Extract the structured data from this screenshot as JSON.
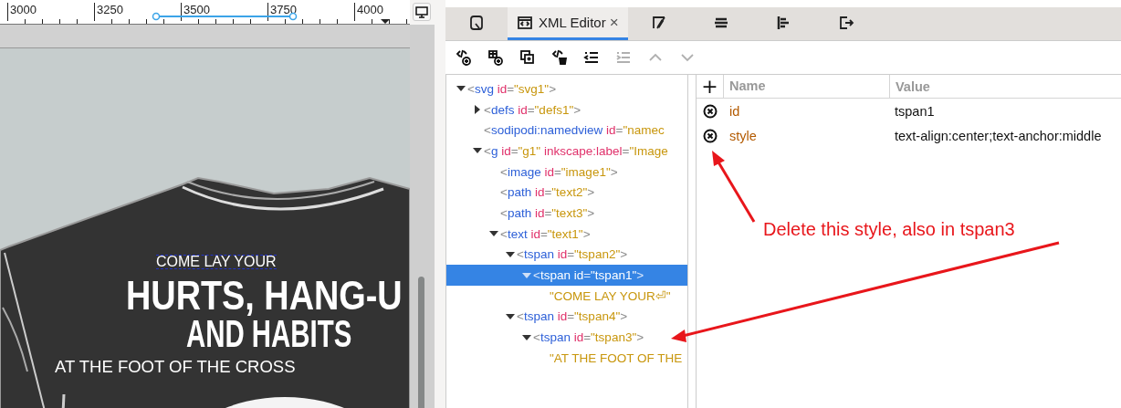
{
  "ruler": {
    "labels": [
      "3000",
      "3250",
      "3500",
      "3750",
      "4000"
    ]
  },
  "canvas": {
    "texts": [
      {
        "text": "COME LAY YOUR",
        "kind": "selected"
      },
      {
        "text": "HURTS, HANG-U",
        "kind": "headline"
      },
      {
        "text": "AND HABITS",
        "kind": "headline2"
      },
      {
        "text": "AT THE FOOT OF THE CROSS",
        "kind": "plain"
      }
    ]
  },
  "tabs": [
    {
      "selected": false
    },
    {
      "label": "XML Editor",
      "close": "×",
      "selected": true
    },
    {
      "selected": false
    },
    {
      "selected": false
    },
    {
      "selected": false
    },
    {
      "selected": false
    }
  ],
  "toolbar": [
    {
      "disabled": false
    },
    {
      "disabled": false
    },
    {
      "disabled": false
    },
    {
      "disabled": false
    },
    {
      "disabled": false
    },
    {
      "disabled": true
    },
    {
      "disabled": true
    },
    {
      "disabled": true
    }
  ],
  "tree": [
    {
      "tokens": [
        {
          "kind": "p",
          "text": "<"
        },
        {
          "kind": "tag",
          "text": "svg"
        },
        {
          "kind": "attr",
          "text": " id"
        },
        {
          "kind": "p",
          "text": "="
        },
        {
          "kind": "val",
          "text": "\"svg1\""
        },
        {
          "kind": "p",
          "text": ">"
        }
      ],
      "expanded": true,
      "selected": false,
      "children": [
        {
          "tokens": [
            {
              "kind": "p",
              "text": "<"
            },
            {
              "kind": "tag",
              "text": "defs"
            },
            {
              "kind": "attr",
              "text": " id"
            },
            {
              "kind": "p",
              "text": "="
            },
            {
              "kind": "val",
              "text": "\"defs1\""
            },
            {
              "kind": "p",
              "text": ">"
            }
          ],
          "expanded": false,
          "selected": false
        },
        {
          "tokens": [
            {
              "kind": "p",
              "text": "<"
            },
            {
              "kind": "tag",
              "text": "sodipodi:namedview"
            },
            {
              "kind": "attr",
              "text": " id"
            },
            {
              "kind": "p",
              "text": "="
            },
            {
              "kind": "val",
              "text": "\"namec"
            }
          ],
          "selected": false
        },
        {
          "tokens": [
            {
              "kind": "p",
              "text": "<"
            },
            {
              "kind": "tag",
              "text": "g"
            },
            {
              "kind": "attr",
              "text": " id"
            },
            {
              "kind": "p",
              "text": "="
            },
            {
              "kind": "val",
              "text": "\"g1\""
            },
            {
              "kind": "attr",
              "text": " inkscape:label"
            },
            {
              "kind": "p",
              "text": "="
            },
            {
              "kind": "val",
              "text": "\"Image"
            }
          ],
          "expanded": true,
          "selected": false,
          "children": [
            {
              "tokens": [
                {
                  "kind": "p",
                  "text": "<"
                },
                {
                  "kind": "tag",
                  "text": "image"
                },
                {
                  "kind": "attr",
                  "text": " id"
                },
                {
                  "kind": "p",
                  "text": "="
                },
                {
                  "kind": "val",
                  "text": "\"image1\""
                },
                {
                  "kind": "p",
                  "text": ">"
                }
              ],
              "selected": false
            },
            {
              "tokens": [
                {
                  "kind": "p",
                  "text": "<"
                },
                {
                  "kind": "tag",
                  "text": "path"
                },
                {
                  "kind": "attr",
                  "text": " id"
                },
                {
                  "kind": "p",
                  "text": "="
                },
                {
                  "kind": "val",
                  "text": "\"text2\""
                },
                {
                  "kind": "p",
                  "text": ">"
                }
              ],
              "selected": false
            },
            {
              "tokens": [
                {
                  "kind": "p",
                  "text": "<"
                },
                {
                  "kind": "tag",
                  "text": "path"
                },
                {
                  "kind": "attr",
                  "text": " id"
                },
                {
                  "kind": "p",
                  "text": "="
                },
                {
                  "kind": "val",
                  "text": "\"text3\""
                },
                {
                  "kind": "p",
                  "text": ">"
                }
              ],
              "selected": false
            },
            {
              "tokens": [
                {
                  "kind": "p",
                  "text": "<"
                },
                {
                  "kind": "tag",
                  "text": "text"
                },
                {
                  "kind": "attr",
                  "text": " id"
                },
                {
                  "kind": "p",
                  "text": "="
                },
                {
                  "kind": "val",
                  "text": "\"text1\""
                },
                {
                  "kind": "p",
                  "text": ">"
                }
              ],
              "expanded": true,
              "selected": false,
              "children": [
                {
                  "tokens": [
                    {
                      "kind": "p",
                      "text": "<"
                    },
                    {
                      "kind": "tag",
                      "text": "tspan"
                    },
                    {
                      "kind": "attr",
                      "text": " id"
                    },
                    {
                      "kind": "p",
                      "text": "="
                    },
                    {
                      "kind": "val",
                      "text": "\"tspan2\""
                    },
                    {
                      "kind": "p",
                      "text": ">"
                    }
                  ],
                  "expanded": true,
                  "selected": false,
                  "children": [
                    {
                      "tokens": [
                        {
                          "kind": "p",
                          "text": "<"
                        },
                        {
                          "kind": "tag",
                          "text": "tspan"
                        },
                        {
                          "kind": "attr",
                          "text": " id"
                        },
                        {
                          "kind": "p",
                          "text": "="
                        },
                        {
                          "kind": "val",
                          "text": "\"tspan1\""
                        },
                        {
                          "kind": "p",
                          "text": ">"
                        }
                      ],
                      "expanded": true,
                      "selected": true,
                      "children": [
                        {
                          "tokens": [
                            {
                              "kind": "val",
                              "text": "\"COME LAY YOUR⏎\""
                            }
                          ],
                          "selected": false
                        }
                      ]
                    }
                  ]
                },
                {
                  "tokens": [
                    {
                      "kind": "p",
                      "text": "<"
                    },
                    {
                      "kind": "tag",
                      "text": "tspan"
                    },
                    {
                      "kind": "attr",
                      "text": " id"
                    },
                    {
                      "kind": "p",
                      "text": "="
                    },
                    {
                      "kind": "val",
                      "text": "\"tspan4\""
                    },
                    {
                      "kind": "p",
                      "text": ">"
                    }
                  ],
                  "expanded": true,
                  "selected": false,
                  "children": [
                    {
                      "tokens": [
                        {
                          "kind": "p",
                          "text": "<"
                        },
                        {
                          "kind": "tag",
                          "text": "tspan"
                        },
                        {
                          "kind": "attr",
                          "text": " id"
                        },
                        {
                          "kind": "p",
                          "text": "="
                        },
                        {
                          "kind": "val",
                          "text": "\"tspan3\""
                        },
                        {
                          "kind": "p",
                          "text": ">"
                        }
                      ],
                      "expanded": true,
                      "selected": false,
                      "children": [
                        {
                          "tokens": [
                            {
                              "kind": "val",
                              "text": "\"AT THE FOOT OF THE"
                            }
                          ],
                          "selected": false
                        }
                      ]
                    }
                  ]
                }
              ]
            }
          ]
        }
      ]
    }
  ],
  "attributes": {
    "add": "+",
    "columns": [
      "Name",
      "Value"
    ],
    "rows": [
      {
        "name": "id",
        "value": "tspan1"
      },
      {
        "name": "style",
        "value": "text-align:center;text-anchor:middle"
      }
    ]
  },
  "annotation": {
    "text": "Delete this style, also in tspan3"
  }
}
